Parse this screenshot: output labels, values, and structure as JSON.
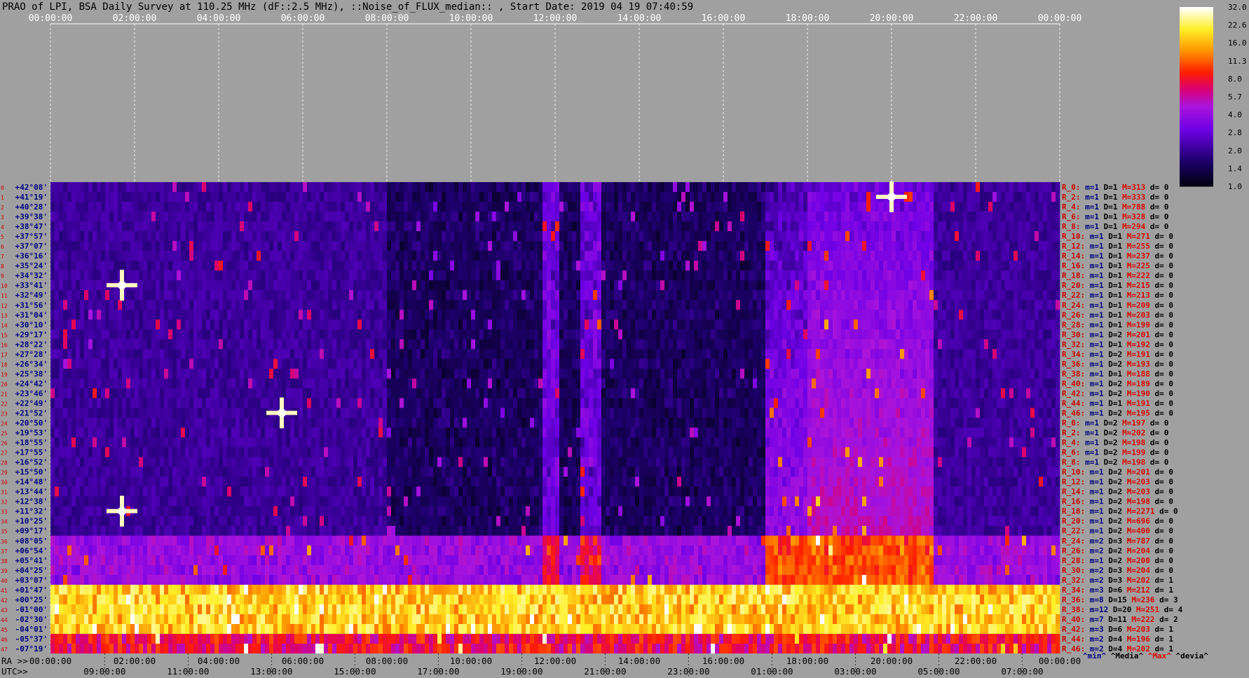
{
  "chart_data": {
    "type": "heatmap",
    "title": "PRAO of LPI, BSA Daily Survey at 110.25 MHz (dF::2.5 MHz), ::Noise_of_FLUX_median:: , Start Date: 2019 04 19 07:40:59",
    "top_axis_ticks": [
      "00:00:00",
      "02:00:00",
      "04:00:00",
      "06:00:00",
      "08:00:00",
      "10:00:00",
      "12:00:00",
      "14:00:00",
      "16:00:00",
      "18:00:00",
      "20:00:00",
      "22:00:00",
      "00:00:00"
    ],
    "ra_axis_label": "RA >>",
    "ra_axis_ticks": [
      "00:00:00",
      "02:00:00",
      "04:00:00",
      "06:00:00",
      "08:00:00",
      "10:00:00",
      "12:00:00",
      "14:00:00",
      "16:00:00",
      "18:00:00",
      "20:00:00",
      "22:00:00",
      "00:00:00"
    ],
    "utc_axis_label": "UTC>>",
    "utc_axis_ticks": [
      "09:00:00",
      "11:00:00",
      "13:00:00",
      "15:00:00",
      "17:00:00",
      "19:00:00",
      "21:00:00",
      "23:00:00",
      "01:00:00",
      "03:00:00",
      "05:00:00",
      "07:00:00"
    ],
    "declinations": [
      "+42°08'",
      "+41°19'",
      "+40°28'",
      "+39°38'",
      "+38°47'",
      "+37°57'",
      "+37°07'",
      "+36°16'",
      "+35°24'",
      "+34°32'",
      "+33°41'",
      "+32°49'",
      "+31°56'",
      "+31°04'",
      "+30°10'",
      "+29°17'",
      "+28°22'",
      "+27°28'",
      "+26°34'",
      "+25°38'",
      "+24°42'",
      "+23°46'",
      "+22°49'",
      "+21°52'",
      "+20°50'",
      "+19°53'",
      "+18°55'",
      "+17°55'",
      "+16°52'",
      "+15°50'",
      "+14°48'",
      "+13°44'",
      "+12°38'",
      "+11°32'",
      "+10°25'",
      "+09°17'",
      "+08°05'",
      "+06°54'",
      "+05°41'",
      "+04°25'",
      "+03°07'",
      "+01°47'",
      "+00°25'",
      "-01°00'",
      "-02°30'",
      "-04°01'",
      "-05°37'",
      "-07°19'"
    ],
    "colorbar_ticks": [
      "32.0",
      "22.6",
      "16.0",
      "11.3",
      "8.0",
      "5.7",
      "4.0",
      "2.8",
      "2.0",
      "1.4",
      "1.0"
    ],
    "colorbar_range": [
      1.0,
      32.0
    ],
    "colorbar_scale": "log",
    "stats_rows": [
      {
        "beam": "R_0:",
        "m": "m=1",
        "D": "D=1",
        "M": "M=313",
        "d": "d= 0"
      },
      {
        "beam": "R_2:",
        "m": "m=1",
        "D": "D=1",
        "M": "M=333",
        "d": "d= 0"
      },
      {
        "beam": "R_4:",
        "m": "m=1",
        "D": "D=1",
        "M": "M=788",
        "d": "d= 0"
      },
      {
        "beam": "R_6:",
        "m": "m=1",
        "D": "D=1",
        "M": "M=328",
        "d": "d= 0"
      },
      {
        "beam": "R_8:",
        "m": "m=1",
        "D": "D=1",
        "M": "M=294",
        "d": "d= 0"
      },
      {
        "beam": "R_10:",
        "m": "m=1",
        "D": "D=1",
        "M": "M=271",
        "d": "d= 0"
      },
      {
        "beam": "R_12:",
        "m": "m=1",
        "D": "D=1",
        "M": "M=255",
        "d": "d= 0"
      },
      {
        "beam": "R_14:",
        "m": "m=1",
        "D": "D=1",
        "M": "M=237",
        "d": "d= 0"
      },
      {
        "beam": "R_16:",
        "m": "m=1",
        "D": "D=1",
        "M": "M=225",
        "d": "d= 0"
      },
      {
        "beam": "R_18:",
        "m": "m=1",
        "D": "D=1",
        "M": "M=222",
        "d": "d= 0"
      },
      {
        "beam": "R_20:",
        "m": "m=1",
        "D": "D=1",
        "M": "M=215",
        "d": "d= 0"
      },
      {
        "beam": "R_22:",
        "m": "m=1",
        "D": "D=1",
        "M": "M=213",
        "d": "d= 0"
      },
      {
        "beam": "R_24:",
        "m": "m=1",
        "D": "D=1",
        "M": "M=209",
        "d": "d= 0"
      },
      {
        "beam": "R_26:",
        "m": "m=1",
        "D": "D=1",
        "M": "M=203",
        "d": "d= 0"
      },
      {
        "beam": "R_28:",
        "m": "m=1",
        "D": "D=1",
        "M": "M=199",
        "d": "d= 0"
      },
      {
        "beam": "R_30:",
        "m": "m=1",
        "D": "D=2",
        "M": "M=201",
        "d": "d= 0"
      },
      {
        "beam": "R_32:",
        "m": "m=1",
        "D": "D=1",
        "M": "M=192",
        "d": "d= 0"
      },
      {
        "beam": "R_34:",
        "m": "m=1",
        "D": "D=2",
        "M": "M=191",
        "d": "d= 0"
      },
      {
        "beam": "R_36:",
        "m": "m=1",
        "D": "D=2",
        "M": "M=193",
        "d": "d= 0"
      },
      {
        "beam": "R_38:",
        "m": "m=1",
        "D": "D=1",
        "M": "M=188",
        "d": "d= 0"
      },
      {
        "beam": "R_40:",
        "m": "m=1",
        "D": "D=2",
        "M": "M=189",
        "d": "d= 0"
      },
      {
        "beam": "R_42:",
        "m": "m=1",
        "D": "D=2",
        "M": "M=190",
        "d": "d= 0"
      },
      {
        "beam": "R_44:",
        "m": "m=1",
        "D": "D=1",
        "M": "M=191",
        "d": "d= 0"
      },
      {
        "beam": "R_46:",
        "m": "m=1",
        "D": "D=2",
        "M": "M=195",
        "d": "d= 0"
      },
      {
        "beam": "R_0:",
        "m": "m=1",
        "D": "D=2",
        "M": "M=197",
        "d": "d= 0"
      },
      {
        "beam": "R_2:",
        "m": "m=1",
        "D": "D=2",
        "M": "M=202",
        "d": "d= 0"
      },
      {
        "beam": "R_4:",
        "m": "m=1",
        "D": "D=2",
        "M": "M=198",
        "d": "d= 0"
      },
      {
        "beam": "R_6:",
        "m": "m=1",
        "D": "D=2",
        "M": "M=199",
        "d": "d= 0"
      },
      {
        "beam": "R_8:",
        "m": "m=1",
        "D": "D=2",
        "M": "M=198",
        "d": "d= 0"
      },
      {
        "beam": "R_10:",
        "m": "m=1",
        "D": "D=2",
        "M": "M=201",
        "d": "d= 0"
      },
      {
        "beam": "R_12:",
        "m": "m=1",
        "D": "D=2",
        "M": "M=203",
        "d": "d= 0"
      },
      {
        "beam": "R_14:",
        "m": "m=1",
        "D": "D=2",
        "M": "M=203",
        "d": "d= 0"
      },
      {
        "beam": "R_16:",
        "m": "m=1",
        "D": "D=2",
        "M": "M=198",
        "d": "d= 0"
      },
      {
        "beam": "R_18:",
        "m": "m=1",
        "D": "D=2",
        "M": "M=2271",
        "d": "d= 0"
      },
      {
        "beam": "R_20:",
        "m": "m=1",
        "D": "D=2",
        "M": "M=696",
        "d": "d= 0"
      },
      {
        "beam": "R_22:",
        "m": "m=1",
        "D": "D=2",
        "M": "M=400",
        "d": "d= 0"
      },
      {
        "beam": "R_24:",
        "m": "m=2",
        "D": "D=3",
        "M": "M=787",
        "d": "d= 0"
      },
      {
        "beam": "R_26:",
        "m": "m=2",
        "D": "D=2",
        "M": "M=204",
        "d": "d= 0"
      },
      {
        "beam": "R_28:",
        "m": "m=1",
        "D": "D=2",
        "M": "M=200",
        "d": "d= 0"
      },
      {
        "beam": "R_30:",
        "m": "m=2",
        "D": "D=3",
        "M": "M=204",
        "d": "d= 0"
      },
      {
        "beam": "R_32:",
        "m": "m=2",
        "D": "D=3",
        "M": "M=202",
        "d": "d= 1"
      },
      {
        "beam": "R_34:",
        "m": "m=3",
        "D": "D=6",
        "M": "M=212",
        "d": "d= 1"
      },
      {
        "beam": "R_36:",
        "m": "m=8",
        "D": "D=15",
        "M": "M=236",
        "d": "d= 3"
      },
      {
        "beam": "R_38:",
        "m": "m=12",
        "D": "D=20",
        "M": "M=251",
        "d": "d= 4"
      },
      {
        "beam": "R_40:",
        "m": "m=7",
        "D": "D=11",
        "M": "M=222",
        "d": "d= 2"
      },
      {
        "beam": "R_42:",
        "m": "m=3",
        "D": "D=6",
        "M": "M=203",
        "d": "d= 1"
      },
      {
        "beam": "R_44:",
        "m": "m=2",
        "D": "D=4",
        "M": "M=196",
        "d": "d= 1"
      },
      {
        "beam": "R_46:",
        "m": "m=2",
        "D": "D=4",
        "M": "M=202",
        "d": "d= 1"
      }
    ],
    "stats_footer": [
      "^min^",
      "^Media^",
      "^Max^",
      "^devia^"
    ],
    "bright_sources": [
      {
        "ra_h": 20.0,
        "dec_row": 1
      },
      {
        "ra_h": 1.7,
        "dec_row": 33
      },
      {
        "ra_h": 5.5,
        "dec_row": 23
      },
      {
        "ra_h": 1.7,
        "dec_row": 10
      }
    ],
    "colors": {
      "background": "#a0a0a0",
      "label_dec": "#000080",
      "label_beam": "#cc0000",
      "stats_m": "#000080",
      "stats_M": "#dd0000",
      "footer_min": "#000080",
      "footer_max": "#dd0000"
    }
  }
}
